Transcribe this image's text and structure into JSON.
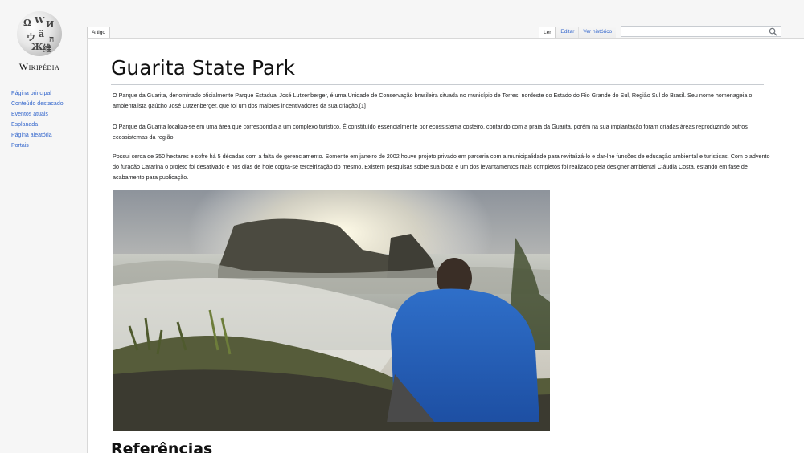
{
  "logo": {
    "wordmark": "Wikipédia"
  },
  "sidebar": {
    "items": [
      {
        "label": "Página principal"
      },
      {
        "label": "Conteúdo destacado"
      },
      {
        "label": "Eventos atuais"
      },
      {
        "label": "Esplanada"
      },
      {
        "label": "Página aleatória"
      },
      {
        "label": "Portais"
      }
    ]
  },
  "tabs": {
    "article": "Artigo",
    "read": "Ler",
    "edit": "Editar",
    "history": "Ver histórico"
  },
  "search": {
    "placeholder": "",
    "value": ""
  },
  "article": {
    "title": "Guarita State Park",
    "paragraphs": [
      "O Parque da Guarita, denominado oficialmente Parque Estadual José Lutzenberger, é uma Unidade de Conservação brasileira situada no município de Torres, nordeste do Estado do Rio Grande do Sul, Região Sul do Brasil. Seu nome homenageia o ambientalista gaúcho José Lutzenberger, que foi um dos maiores incentivadores da sua criação.[1]",
      "O Parque da Guarita localiza-se em uma área que correspondia a um complexo turístico. É constituído essencialmente por ecossistema costeiro, contando com a praia da Guarita, porém na sua implantação foram criadas áreas reproduzindo outros ecossistemas da região.",
      "Possui cerca de 350 hectares e sofre há 5 décadas com a falta de gerenciamento. Somente em janeiro de 2002 houve projeto privado em parceria com a municipalidade para revitalizá-lo e dar-lhe funções de educação ambiental e turísticas. Com o advento do furacão Catarina o projeto foi desativado e nos dias de hoje cogita-se terceirização do mesmo. Existem pesquisas sobre sua biota e um dos levantamentos mais completos foi realizado pela designer ambiental Cláudia Costa, estando em fase de acabamento para publicação."
    ],
    "references_heading": "Referências"
  },
  "colors": {
    "link": "#3366cc",
    "text": "#202122",
    "background": "#f6f6f6",
    "content_bg": "#ffffff"
  },
  "icons": {
    "search": "search-icon",
    "logo": "wikipedia-globe-icon"
  }
}
